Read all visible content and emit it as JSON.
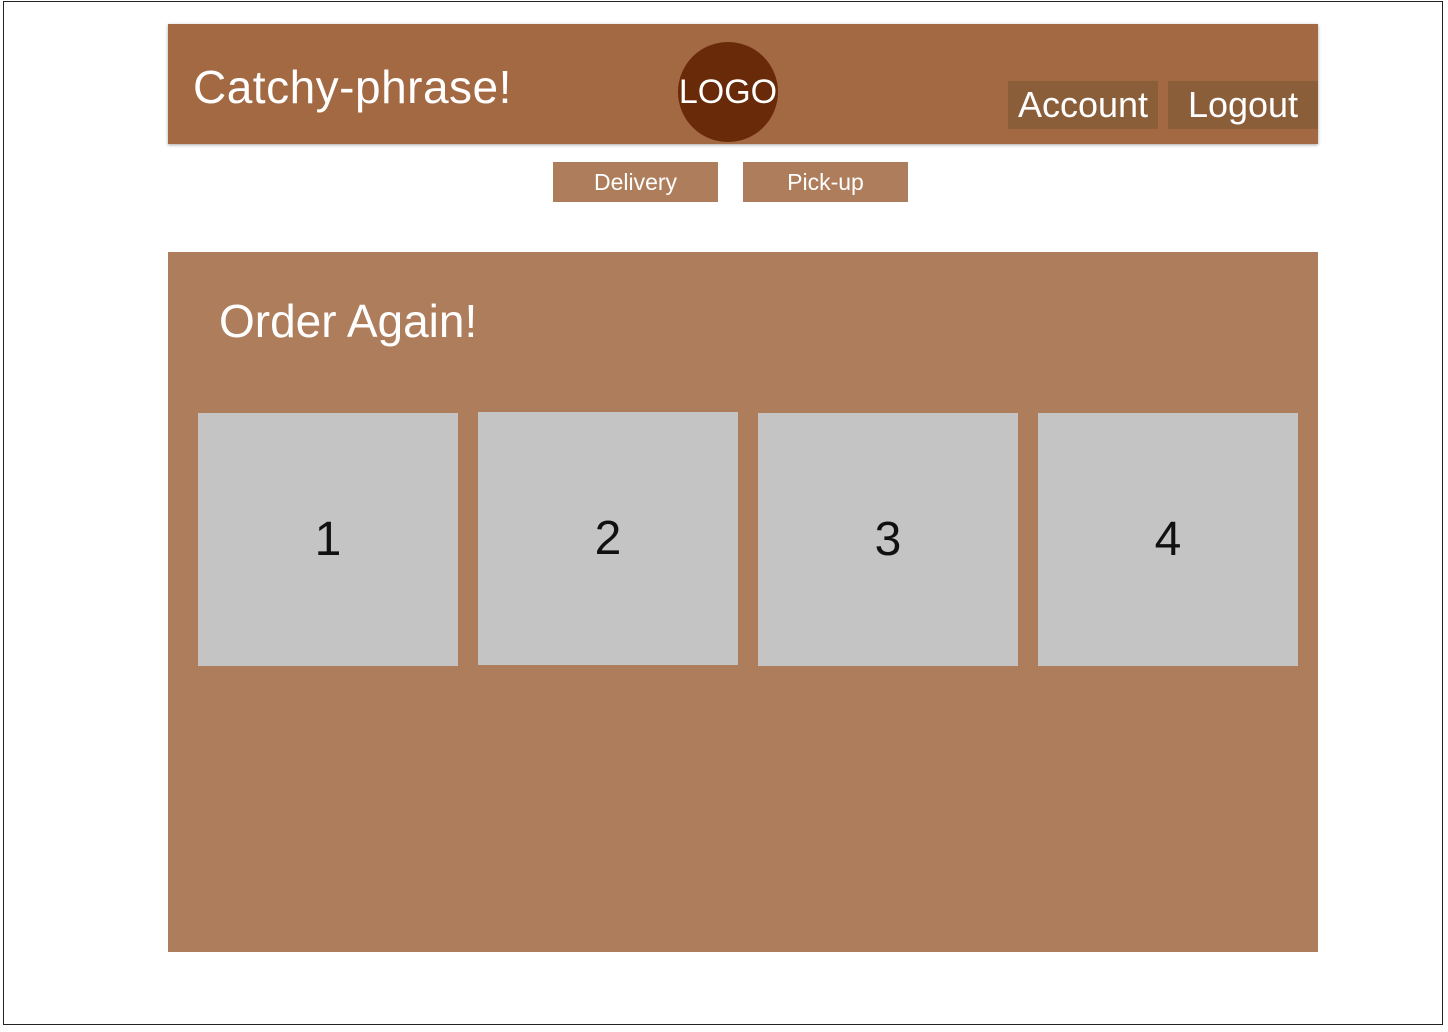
{
  "header": {
    "tagline": "Catchy-phrase!",
    "logo_text": "LOGO",
    "account_label": "Account",
    "logout_label": "Logout"
  },
  "order_modes": {
    "delivery_label": "Delivery",
    "pickup_label": "Pick-up"
  },
  "order_again": {
    "title": "Order Again!",
    "items": [
      {
        "label": "1"
      },
      {
        "label": "2"
      },
      {
        "label": "3"
      },
      {
        "label": "4"
      }
    ]
  },
  "colors": {
    "header_bg": "#a36942",
    "logo_bg": "#682a08",
    "nav_button_bg": "#8b5e3a",
    "panel_bg": "#ae7d5b",
    "tile_bg": "#c4c4c4"
  }
}
